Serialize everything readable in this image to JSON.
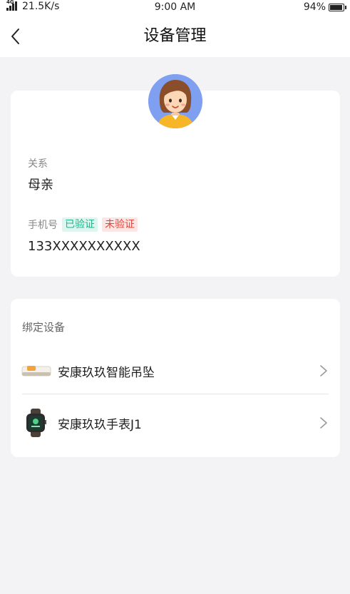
{
  "status_bar": {
    "network_type": "4G",
    "speed": "21.5K/s",
    "time": "9:00 AM",
    "battery": "94%"
  },
  "nav": {
    "title": "设备管理"
  },
  "profile": {
    "relation_label": "关系",
    "relation_value": "母亲",
    "phone_label": "手机号",
    "tag_verified": "已验证",
    "tag_unverified": "未验证",
    "phone_value": "133XXXXXXXXXX"
  },
  "devices": {
    "title": "绑定设备",
    "items": [
      {
        "name": "安康玖玖智能吊坠",
        "icon": "pendant-device-icon"
      },
      {
        "name": "安康玖玖手表J1",
        "icon": "smartwatch-device-icon"
      }
    ]
  },
  "colors": {
    "verified": "#1fb38b",
    "unverified": "#e0463b",
    "avatar_bg": "#7f9ff1"
  }
}
